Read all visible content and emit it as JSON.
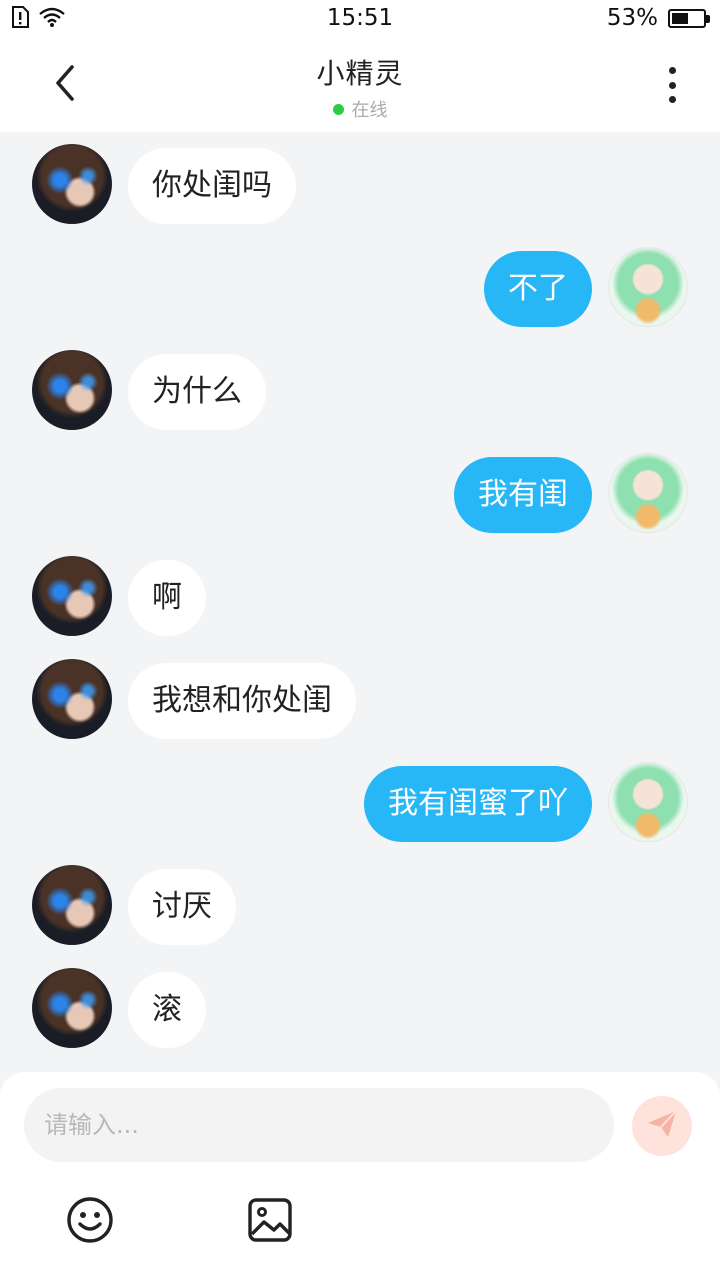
{
  "status_bar": {
    "time": "15:51",
    "battery_percent": "53%",
    "battery_level": 0.53,
    "icons": [
      "sim-alert-icon",
      "wifi-icon",
      "battery-icon"
    ]
  },
  "header": {
    "title": "小精灵",
    "status": "在线",
    "status_color": "#2ecc40",
    "icons": [
      "back-arrow-icon",
      "more-vertical-icon"
    ]
  },
  "messages": [
    {
      "side": "left",
      "text": "你处闺吗"
    },
    {
      "side": "right",
      "text": "不了"
    },
    {
      "side": "left",
      "text": "为什么"
    },
    {
      "side": "right",
      "text": "我有闺"
    },
    {
      "side": "left",
      "text": "啊"
    },
    {
      "side": "left",
      "text": "我想和你处闺"
    },
    {
      "side": "right",
      "text": "我有闺蜜了吖"
    },
    {
      "side": "left",
      "text": "讨厌"
    },
    {
      "side": "left",
      "text": "滚"
    }
  ],
  "input": {
    "placeholder": "请输入..."
  },
  "toolbar": {
    "icons": [
      "send-icon",
      "emoji-icon",
      "image-icon"
    ]
  },
  "colors": {
    "sent_bubble": "#27b6f6",
    "received_bubble": "#ffffff",
    "background": "#f3f4f6"
  }
}
